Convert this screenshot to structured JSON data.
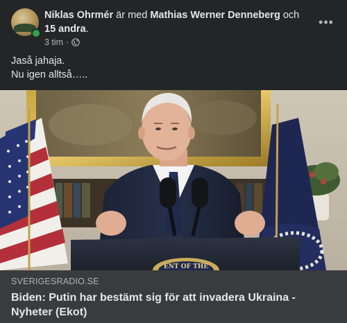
{
  "post": {
    "author": "Niklas Ohrmér",
    "connector_with": " är med ",
    "tagged_person": "Mathias Werner Denneberg",
    "connector_and": " och ",
    "others": "15 andra",
    "trailing": ".",
    "timestamp": "3 tim",
    "separator": " · ",
    "privacy_icon": "globe-icon",
    "more_icon": "more-options-icon",
    "more_label": "•••",
    "text_lines": [
      "Jaså jahaja.",
      "Nu igen alltså….."
    ]
  },
  "link_preview": {
    "domain": "SVERIGESRADIO.SE",
    "headline": "Biden: Putin har bestämt sig för att invadera Ukraina - Nyheter (Ekot)",
    "podium_seal_text": "ENT OF THE"
  },
  "colors": {
    "background": "#242526",
    "footer": "#3a3b3c",
    "primary_text": "#e4e6eb",
    "secondary_text": "#b0b3b8",
    "online": "#31a24c"
  }
}
